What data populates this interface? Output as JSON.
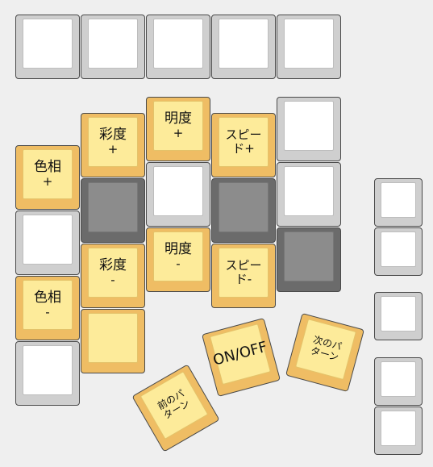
{
  "keys": {
    "top1": {
      "l1": "",
      "l2": ""
    },
    "top2": {
      "l1": "",
      "l2": ""
    },
    "top3": {
      "l1": "",
      "l2": ""
    },
    "top4": {
      "l1": "",
      "l2": ""
    },
    "top5": {
      "l1": "",
      "l2": ""
    },
    "hue_up": {
      "l1": "色相",
      "l2": "+"
    },
    "hue_down": {
      "l1": "色相",
      "l2": "-"
    },
    "sat_up": {
      "l1": "彩度",
      "l2": "+"
    },
    "sat_down": {
      "l1": "彩度",
      "l2": "-"
    },
    "val_up": {
      "l1": "明度",
      "l2": "+"
    },
    "val_down": {
      "l1": "明度",
      "l2": "-"
    },
    "speed_up": {
      "l1": "スピー",
      "l2": "ド+"
    },
    "speed_down": {
      "l1": "スピー",
      "l2": "ド-"
    },
    "on_off": {
      "label": "ON/OFF"
    },
    "prev_pattern": {
      "l1": "前のパ",
      "l2": "ターン"
    },
    "next_pattern": {
      "l1": "次のパ",
      "l2": "ターン"
    }
  },
  "colors": {
    "background": "#efefef",
    "white_key_outer": "#cfcfcf",
    "white_key_top": "#ffffff",
    "dark_key_outer": "#6b6b6b",
    "dark_key_top": "#8c8c8c",
    "orange_key_outer": "#efbd64",
    "orange_key_top": "#fdeb9a"
  }
}
